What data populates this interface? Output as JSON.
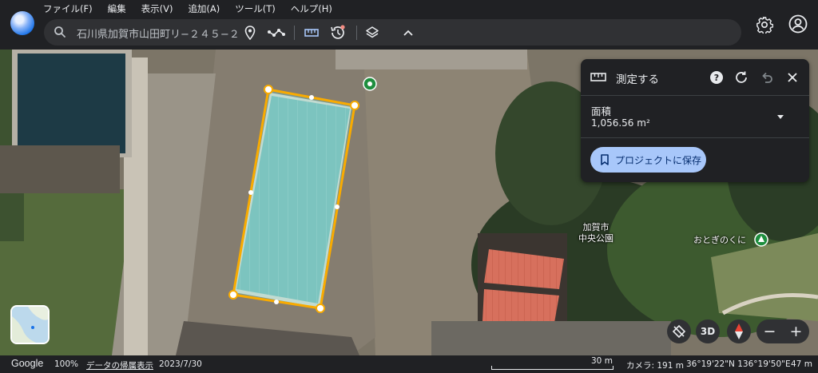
{
  "menu": [
    "ファイル(F)",
    "編集",
    "表示(V)",
    "追加(A)",
    "ツール(T)",
    "ヘルプ(H)"
  ],
  "search": {
    "value": "石川県加賀市山田町リ−２４５−２"
  },
  "toolbar": {
    "icons": [
      "place-pin-icon",
      "path-icon",
      "ruler-icon",
      "history-icon",
      "layers-icon",
      "chevron-up-icon"
    ],
    "history_badge_color": "#f28b82"
  },
  "header_icons": [
    "gear-icon",
    "account-icon"
  ],
  "measure": {
    "title": "測定する",
    "area_label": "面積",
    "area_value": "1,056.56 m²",
    "save_label": "プロジェクトに保存"
  },
  "map_labels": {
    "park": "加賀市\n中央公園",
    "place": "おとぎのくに"
  },
  "colors": {
    "polygon_stroke": "#f9ab00",
    "accent": "#a8c7fa",
    "pin_green": "#1e8e3e"
  },
  "controls": {
    "btn3d": "3D",
    "zoom_out": "−",
    "zoom_in": "+"
  },
  "status": {
    "brand": "Google",
    "zoom": "100%",
    "attribution": "データの帰属表示",
    "date": "2023/7/30",
    "scale": "30 m",
    "camera": "カメラ: 191 m",
    "coords": "36°19'22\"N 136°19'50\"E",
    "elevation": "47 m"
  }
}
